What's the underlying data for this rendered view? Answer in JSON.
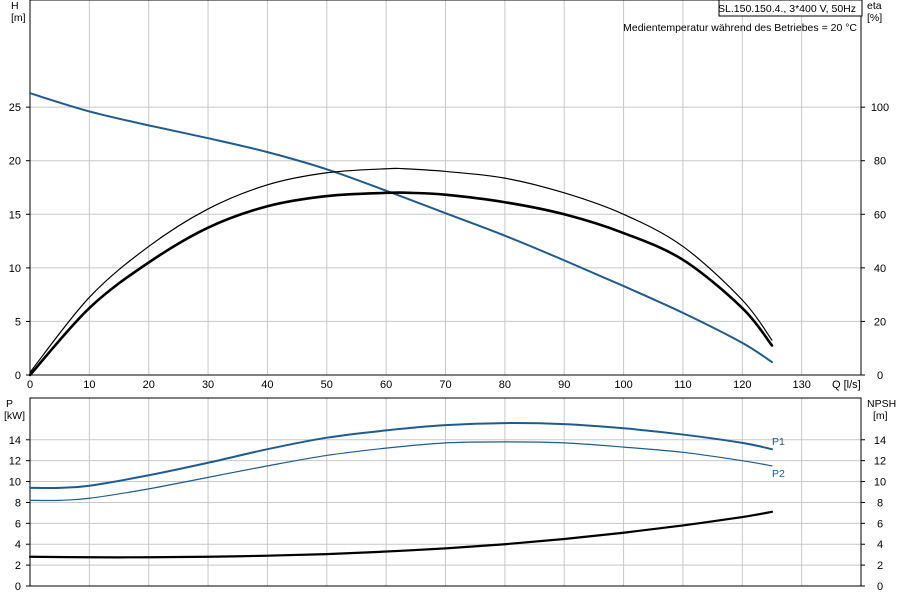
{
  "chart_data": [
    {
      "type": "line",
      "title": "SL.150.150.4., 3*400 V, 50Hz",
      "subtitle": "Medientemperatur während des Betriebes = 20 °C",
      "x_axis": {
        "unit_label": "Q [l/s]",
        "range": [
          0,
          140
        ],
        "ticks": [
          0,
          10,
          20,
          30,
          40,
          50,
          60,
          70,
          80,
          90,
          100,
          110,
          120,
          130
        ]
      },
      "y_left": {
        "label": "H",
        "unit": "[m]",
        "range": [
          0,
          35
        ],
        "ticks": [
          0,
          5,
          10,
          15,
          20,
          25
        ]
      },
      "y_right": {
        "label": "eta",
        "unit": "[%]",
        "range": [
          0,
          140
        ],
        "ticks": [
          0,
          20,
          40,
          60,
          80,
          100
        ]
      },
      "grid": true,
      "series": [
        {
          "axis": "left",
          "color": "#1f5b8e",
          "width": 2,
          "x": [
            0,
            10,
            20,
            30,
            40,
            50,
            60,
            70,
            80,
            90,
            100,
            110,
            120,
            125
          ],
          "y": [
            26.3,
            24.6,
            23.3,
            22.1,
            20.8,
            19.2,
            17.2,
            15.1,
            13,
            10.7,
            8.3,
            5.8,
            3,
            1.2
          ]
        },
        {
          "axis": "right",
          "color": "#000000",
          "width": 1.2,
          "x": [
            0,
            10,
            20,
            30,
            40,
            50,
            60,
            63,
            70,
            80,
            90,
            100,
            110,
            120,
            125
          ],
          "y": [
            1,
            29,
            48,
            62,
            71,
            75.5,
            77,
            77,
            76,
            73.5,
            68,
            60,
            48,
            28,
            13
          ]
        },
        {
          "axis": "right",
          "color": "#000000",
          "width": 2.6,
          "x": [
            0,
            10,
            20,
            30,
            40,
            50,
            60,
            64,
            70,
            80,
            90,
            100,
            110,
            120,
            125
          ],
          "y": [
            0,
            25,
            42,
            55,
            63,
            66.8,
            68,
            68,
            67.3,
            64.5,
            60,
            53,
            43,
            25,
            11
          ]
        }
      ]
    },
    {
      "type": "line",
      "x_axis": {
        "range": [
          0,
          140
        ],
        "ticks": [
          0,
          10,
          20,
          30,
          40,
          50,
          60,
          70,
          80,
          90,
          100,
          110,
          120,
          130
        ]
      },
      "y_left": {
        "label": "P",
        "unit": "[kW]",
        "range": [
          0,
          18
        ],
        "ticks": [
          0,
          2,
          4,
          6,
          8,
          10,
          12,
          14
        ]
      },
      "y_right": {
        "label": "NPSH",
        "unit": "[m]",
        "range": [
          0,
          18
        ],
        "ticks": [
          0,
          2,
          4,
          6,
          8,
          10,
          12,
          14
        ]
      },
      "grid": true,
      "series": [
        {
          "name": "P1",
          "axis": "left",
          "color": "#1f5b8e",
          "width": 2,
          "x": [
            0,
            5,
            10,
            20,
            30,
            40,
            50,
            60,
            70,
            80,
            90,
            100,
            110,
            120,
            125
          ],
          "y": [
            9.4,
            9.4,
            9.6,
            10.6,
            11.8,
            13.1,
            14.2,
            14.9,
            15.4,
            15.6,
            15.5,
            15.1,
            14.5,
            13.7,
            13.1
          ]
        },
        {
          "name": "P2",
          "axis": "left",
          "color": "#1f5b8e",
          "width": 1.2,
          "x": [
            0,
            5,
            10,
            20,
            30,
            40,
            50,
            60,
            70,
            80,
            90,
            100,
            110,
            120,
            125
          ],
          "y": [
            8.2,
            8.2,
            8.4,
            9.3,
            10.4,
            11.5,
            12.5,
            13.2,
            13.7,
            13.8,
            13.7,
            13.3,
            12.8,
            12,
            11.5
          ]
        },
        {
          "axis": "right",
          "color": "#000000",
          "width": 2.2,
          "x": [
            0,
            10,
            20,
            30,
            40,
            50,
            60,
            70,
            80,
            90,
            100,
            110,
            120,
            125
          ],
          "y": [
            2.8,
            2.75,
            2.75,
            2.8,
            2.9,
            3.05,
            3.3,
            3.6,
            4,
            4.5,
            5.1,
            5.8,
            6.6,
            7.1
          ]
        }
      ]
    }
  ]
}
